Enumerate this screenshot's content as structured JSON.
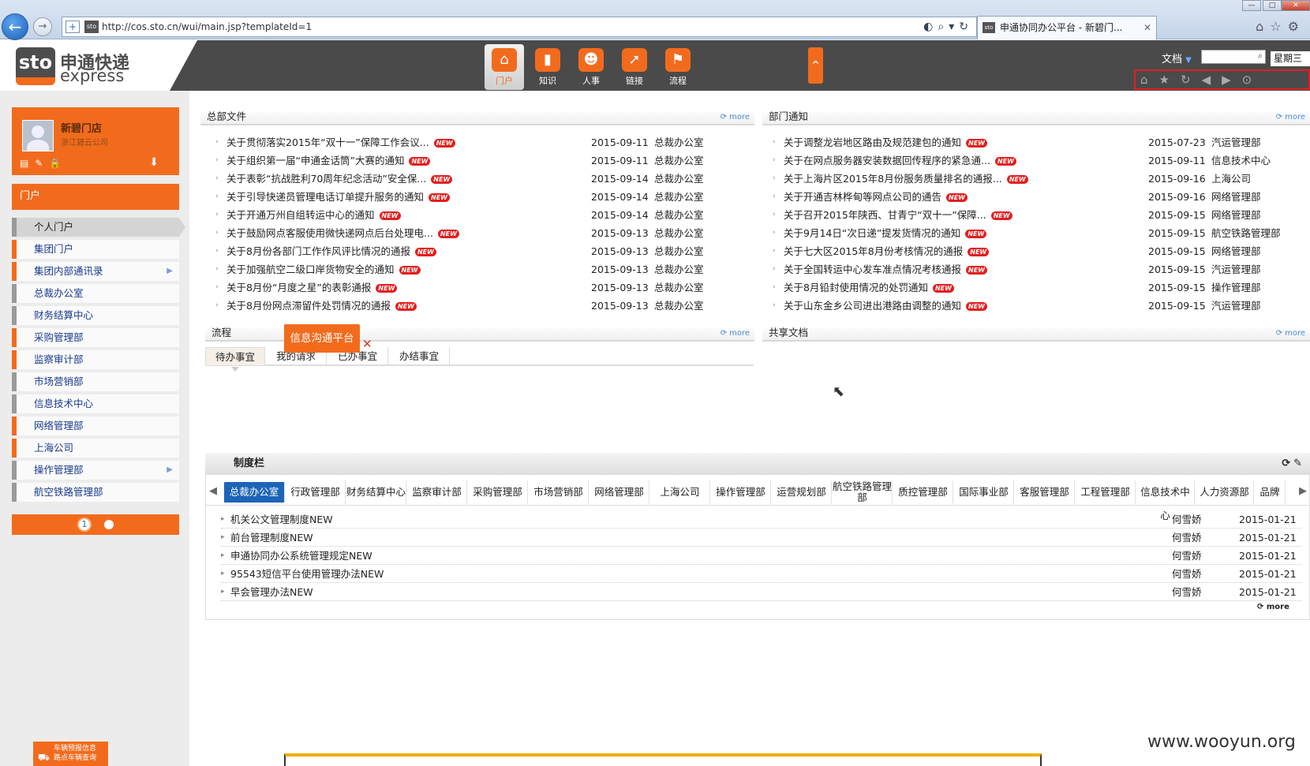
{
  "browser": {
    "url": "http://cos.sto.cn/wui/main.jsp?templateId=1",
    "tab_title": "申通协同办公平台 - 新碧门...",
    "site_icon": "sto"
  },
  "header": {
    "logo_mark": "sto",
    "logo_sub": "express",
    "logo_cn": "申通快递",
    "logo_en": "express",
    "modules": [
      {
        "label": "门户",
        "icon": "⌂"
      },
      {
        "label": "知识",
        "icon": "▮"
      },
      {
        "label": "人事",
        "icon": "☻"
      },
      {
        "label": "链接",
        "icon": "➚"
      },
      {
        "label": "流程",
        "icon": "⚑"
      }
    ],
    "collapse_icon": "^",
    "doc_select": "文档",
    "weekday": "星期三"
  },
  "profile": {
    "name": "新碧门店",
    "company": "浙江碧云公司"
  },
  "portal_bar_label": "门户",
  "sidebar": {
    "items": [
      {
        "label": "个人门户",
        "style": "selected",
        "sub": false
      },
      {
        "label": "集团门户",
        "style": "orange",
        "sub": false
      },
      {
        "label": "集团内部通讯录",
        "style": "orange",
        "sub": true
      },
      {
        "label": "总裁办公室",
        "style": "gray",
        "sub": false
      },
      {
        "label": "财务结算中心",
        "style": "gray",
        "sub": false
      },
      {
        "label": "采购管理部",
        "style": "orange",
        "sub": false
      },
      {
        "label": "监察审计部",
        "style": "orange",
        "sub": false
      },
      {
        "label": "市场营销部",
        "style": "gray",
        "sub": false
      },
      {
        "label": "信息技术中心",
        "style": "gray",
        "sub": false
      },
      {
        "label": "网络管理部",
        "style": "orange",
        "sub": false
      },
      {
        "label": "上海公司",
        "style": "orange",
        "sub": false
      },
      {
        "label": "操作管理部",
        "style": "gray",
        "sub": true
      },
      {
        "label": "航空铁路管理部",
        "style": "gray",
        "sub": false
      }
    ],
    "pager_current": "1"
  },
  "vehicle": {
    "line1": "车辆预报信息",
    "line2": "路点车辆查询"
  },
  "more_label": "more",
  "new_badge": "NEW",
  "hq_files": {
    "title": "总部文件",
    "rows": [
      {
        "title": "关于贯彻落实2015年“双十一”保障工作会议...",
        "date": "2015-09-11",
        "dept": "总裁办公室"
      },
      {
        "title": "关于组织第一届“申通金话筒”大赛的通知",
        "date": "2015-09-11",
        "dept": "总裁办公室"
      },
      {
        "title": "关于表彰“抗战胜利70周年纪念活动”安全保...",
        "date": "2015-09-14",
        "dept": "总裁办公室"
      },
      {
        "title": "关于引导快递员管理电话订单提升服务的通知",
        "date": "2015-09-14",
        "dept": "总裁办公室"
      },
      {
        "title": "关于开通万州自组转运中心的通知",
        "date": "2015-09-14",
        "dept": "总裁办公室"
      },
      {
        "title": "关于鼓励网点客服使用微快递网点后台处理电...",
        "date": "2015-09-13",
        "dept": "总裁办公室"
      },
      {
        "title": "关于8月份各部门工作作风评比情况的通报",
        "date": "2015-09-13",
        "dept": "总裁办公室"
      },
      {
        "title": "关于加强航空二级口岸货物安全的通知",
        "date": "2015-09-13",
        "dept": "总裁办公室"
      },
      {
        "title": "关于8月份“月度之星”的表彰通报",
        "date": "2015-09-13",
        "dept": "总裁办公室"
      },
      {
        "title": "关于8月份网点滞留件处罚情况的通报",
        "date": "2015-09-13",
        "dept": "总裁办公室"
      }
    ]
  },
  "dept_notice": {
    "title": "部门通知",
    "rows": [
      {
        "title": "关于调整龙岩地区路由及规范建包的通知",
        "date": "2015-07-23",
        "dept": "汽运管理部"
      },
      {
        "title": "关于在网点服务器安装数据回传程序的紧急通...",
        "date": "2015-09-11",
        "dept": "信息技术中心"
      },
      {
        "title": "关于上海片区2015年8月份服务质量排名的通报...",
        "date": "2015-09-16",
        "dept": "上海公司"
      },
      {
        "title": "关于开通吉林桦甸等网点公司的通告",
        "date": "2015-09-16",
        "dept": "网络管理部"
      },
      {
        "title": "关于召开2015年陕西、甘青宁“双十一”保障...",
        "date": "2015-09-15",
        "dept": "网络管理部"
      },
      {
        "title": "关于9月14日“次日递”提发货情况的通知",
        "date": "2015-09-15",
        "dept": "航空铁路管理部"
      },
      {
        "title": "关于七大区2015年8月份考核情况的通报",
        "date": "2015-09-15",
        "dept": "网络管理部"
      },
      {
        "title": "关于全国转运中心发车准点情况考核通报",
        "date": "2015-09-15",
        "dept": "汽运管理部"
      },
      {
        "title": "关于8月铅封使用情况的处罚通知",
        "date": "2015-09-15",
        "dept": "操作管理部"
      },
      {
        "title": "关于山东金乡公司进出港路由调整的通知",
        "date": "2015-09-15",
        "dept": "汽运管理部"
      }
    ]
  },
  "process": {
    "title": "流程",
    "tabs": [
      "待办事宜",
      "我的请求",
      "已办事宜",
      "办结事宜"
    ]
  },
  "shared_docs": {
    "title": "共享文档"
  },
  "tooltip": {
    "label": "信息沟通平台",
    "close": "✕"
  },
  "system": {
    "title": "制度栏",
    "tabs": [
      "总裁办公室",
      "行政管理部",
      "财务结算中心",
      "监察审计部",
      "采购管理部",
      "市场营销部",
      "网络管理部",
      "上海公司",
      "操作管理部",
      "运营规划部",
      "航空铁路管理部",
      "质控管理部",
      "国际事业部",
      "客服管理部",
      "工程管理部",
      "信息技术中心",
      "人力资源部",
      "品牌"
    ],
    "rows": [
      {
        "title": "机关公文管理制度",
        "author": "何雪娇",
        "date": "2015-01-21"
      },
      {
        "title": "前台管理制度",
        "author": "何雪娇",
        "date": "2015-01-21"
      },
      {
        "title": "申通协同办公系统管理规定",
        "author": "何雪娇",
        "date": "2015-01-21"
      },
      {
        "title": "95543短信平台使用管理办法",
        "author": "何雪娇",
        "date": "2015-01-21"
      },
      {
        "title": "早会管理办法",
        "author": "何雪娇",
        "date": "2015-01-21"
      }
    ]
  },
  "watermark": "www.wooyun.org",
  "colors": {
    "accent": "#f26b1d",
    "header": "#4a4a4a",
    "tab_active": "#1c64b8",
    "new_badge": "#e41e1e"
  }
}
